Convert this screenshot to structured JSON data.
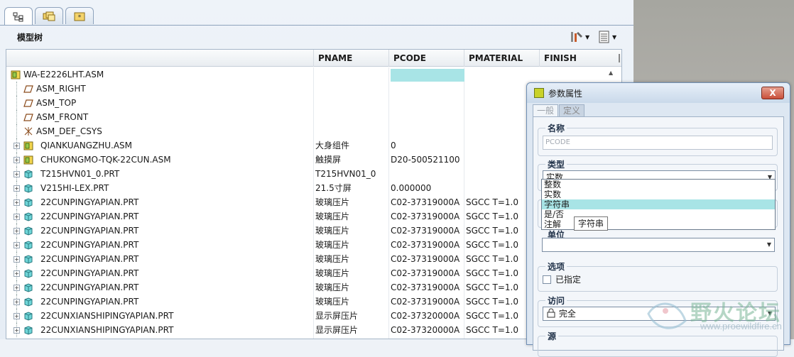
{
  "panel": {
    "title": "模型树",
    "columns": [
      "PNAME",
      "PCODE",
      "PMATERIAL",
      "FINISH"
    ]
  },
  "tree_rows": [
    {
      "name": "WA-E2226LHT.ASM",
      "pname": "",
      "pcode": "",
      "pmaterial": "",
      "icon": "assembly-icon",
      "level": 0,
      "expander": false
    },
    {
      "name": "ASM_RIGHT",
      "pname": "",
      "pcode": "",
      "pmaterial": "",
      "icon": "datum-plane-icon",
      "level": 1,
      "expander": false
    },
    {
      "name": "ASM_TOP",
      "pname": "",
      "pcode": "",
      "pmaterial": "",
      "icon": "datum-plane-icon",
      "level": 1,
      "expander": false
    },
    {
      "name": "ASM_FRONT",
      "pname": "",
      "pcode": "",
      "pmaterial": "",
      "icon": "datum-plane-icon",
      "level": 1,
      "expander": false
    },
    {
      "name": "ASM_DEF_CSYS",
      "pname": "",
      "pcode": "",
      "pmaterial": "",
      "icon": "csys-icon",
      "level": 1,
      "expander": false
    },
    {
      "name": "QIANKUANGZHU.ASM",
      "pname": "大身组件",
      "pcode": "0",
      "pmaterial": "",
      "icon": "assembly-icon",
      "level": 1,
      "expander": true
    },
    {
      "name": "CHUKONGMO-TQK-22CUN.ASM",
      "pname": "触摸屏",
      "pcode": "D20-500521100",
      "pmaterial": "",
      "icon": "assembly-icon",
      "level": 1,
      "expander": true
    },
    {
      "name": "T215HVN01_0.PRT",
      "pname": "T215HVN01_0",
      "pcode": "",
      "pmaterial": "",
      "icon": "part-icon",
      "level": 1,
      "expander": true
    },
    {
      "name": "V215HI-LEX.PRT",
      "pname": "21.5寸屏",
      "pcode": "0.000000",
      "pmaterial": "",
      "icon": "part-icon",
      "level": 1,
      "expander": true
    },
    {
      "name": "22CUNPINGYAPIAN.PRT",
      "pname": "玻璃压片",
      "pcode": "C02-37319000A",
      "pmaterial": "SGCC T=1.0",
      "icon": "part-icon",
      "level": 1,
      "expander": true
    },
    {
      "name": "22CUNPINGYAPIAN.PRT",
      "pname": "玻璃压片",
      "pcode": "C02-37319000A",
      "pmaterial": "SGCC T=1.0",
      "icon": "part-icon",
      "level": 1,
      "expander": true
    },
    {
      "name": "22CUNPINGYAPIAN.PRT",
      "pname": "玻璃压片",
      "pcode": "C02-37319000A",
      "pmaterial": "SGCC T=1.0",
      "icon": "part-icon",
      "level": 1,
      "expander": true
    },
    {
      "name": "22CUNPINGYAPIAN.PRT",
      "pname": "玻璃压片",
      "pcode": "C02-37319000A",
      "pmaterial": "SGCC T=1.0",
      "icon": "part-icon",
      "level": 1,
      "expander": true
    },
    {
      "name": "22CUNPINGYAPIAN.PRT",
      "pname": "玻璃压片",
      "pcode": "C02-37319000A",
      "pmaterial": "SGCC T=1.0",
      "icon": "part-icon",
      "level": 1,
      "expander": true
    },
    {
      "name": "22CUNPINGYAPIAN.PRT",
      "pname": "玻璃压片",
      "pcode": "C02-37319000A",
      "pmaterial": "SGCC T=1.0",
      "icon": "part-icon",
      "level": 1,
      "expander": true
    },
    {
      "name": "22CUNPINGYAPIAN.PRT",
      "pname": "玻璃压片",
      "pcode": "C02-37319000A",
      "pmaterial": "SGCC T=1.0",
      "icon": "part-icon",
      "level": 1,
      "expander": true
    },
    {
      "name": "22CUNPINGYAPIAN.PRT",
      "pname": "玻璃压片",
      "pcode": "C02-37319000A",
      "pmaterial": "SGCC T=1.0",
      "icon": "part-icon",
      "level": 1,
      "expander": true
    },
    {
      "name": "22CUNXIANSHIPINGYAPIAN.PRT",
      "pname": "显示屏压片",
      "pcode": "C02-37320000A",
      "pmaterial": "SGCC T=1.0",
      "icon": "part-icon",
      "level": 1,
      "expander": true
    },
    {
      "name": "22CUNXIANSHIPINGYAPIAN.PRT",
      "pname": "显示屏压片",
      "pcode": "C02-37320000A",
      "pmaterial": "SGCC T=1.0",
      "icon": "part-icon",
      "level": 1,
      "expander": true
    }
  ],
  "dialog": {
    "title": "参数属性",
    "close_label": "X",
    "tabs": [
      "一般",
      "定义"
    ],
    "name_group": "名称",
    "name_value": "PCODE",
    "type_group": "类型",
    "type_selected": "实数",
    "type_options": [
      "整数",
      "实数",
      "字符串",
      "是/否",
      "注解"
    ],
    "tooltip": "字符串",
    "unit_group": "单位",
    "options_group": "选项",
    "designated_label": "已指定",
    "access_group": "访问",
    "access_value": "完全",
    "source_group": "源"
  },
  "watermark": {
    "text": "野火论坛",
    "url": "www.proewildfire.cn"
  }
}
